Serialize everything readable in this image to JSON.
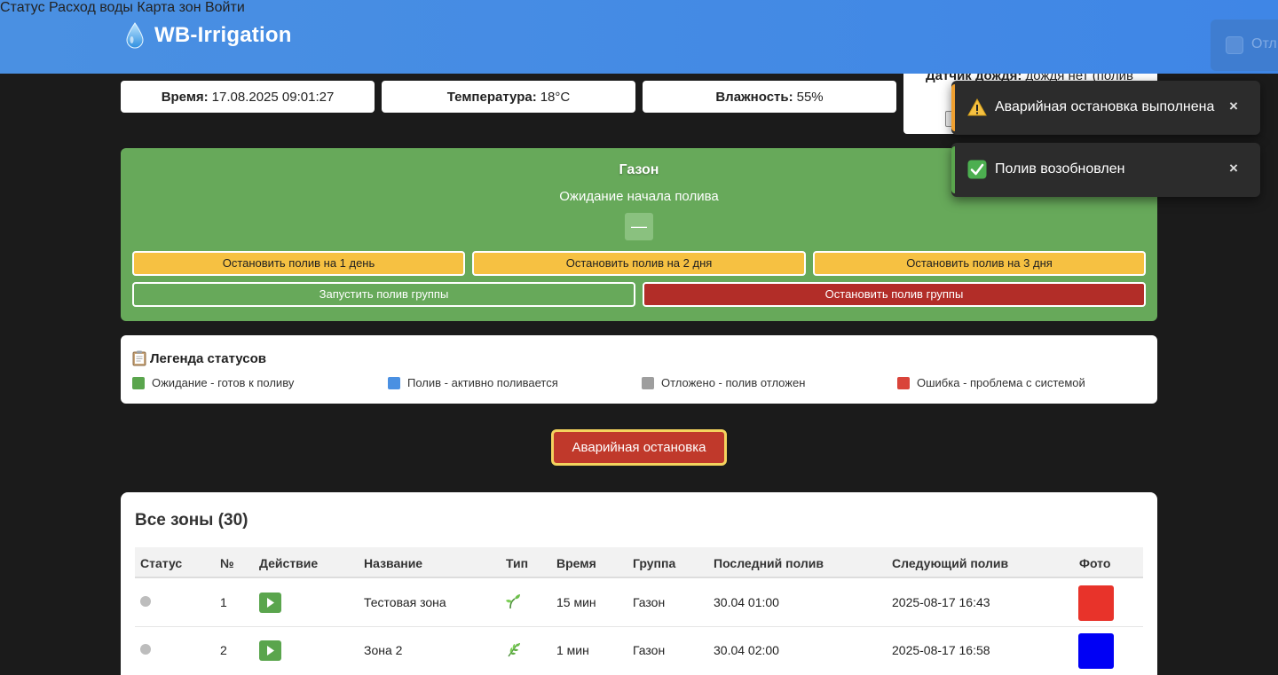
{
  "app": {
    "title": "WB-Irrigation"
  },
  "nav": [
    "Статус",
    "Расход воды",
    "Карта зон",
    "Войти"
  ],
  "ghost_toast": {
    "text": "Отл"
  },
  "info": {
    "time_label": "Время:",
    "time_value": "17.08.2025 09:01:27",
    "temp_label": "Температура:",
    "temp_value": "18°C",
    "humidity_label": "Влажность:",
    "humidity_value": "55%",
    "rain_label": "Датчик дождя:",
    "rain_value": "дождя нет (полив"
  },
  "group": {
    "title": "Газон",
    "status": "Ожидание начала полива",
    "dash": "—",
    "stop_buttons": [
      "Остановить полив на 1 день",
      "Остановить полив на 2 дня",
      "Остановить полив на 3 дня"
    ],
    "start_label": "Запустить полив группы",
    "stop_label": "Остановить полив группы"
  },
  "legend": {
    "title": "Легенда статусов",
    "items": [
      {
        "text": "Ожидание - готов к поливу",
        "color": "#5aa54d"
      },
      {
        "text": "Полив - активно поливается",
        "color": "#4a90e2"
      },
      {
        "text": "Отложено - полив отложен",
        "color": "#9e9e9e"
      },
      {
        "text": "Ошибка - проблема с системой",
        "color": "#d9443a"
      }
    ]
  },
  "emergency_label": "Аварийная остановка",
  "zones": {
    "title": "Все зоны (30)",
    "columns": [
      "Статус",
      "№",
      "Действие",
      "Название",
      "Тип",
      "Время",
      "Группа",
      "Последний полив",
      "Следующий полив",
      "Фото"
    ],
    "rows": [
      {
        "num": "1",
        "name": "Тестовая зона",
        "type_icon": "seedling-icon",
        "time": "15 мин",
        "group": "Газон",
        "last": "30.04 01:00",
        "next": "2025-08-17 16:43",
        "photo_color": "#e8332a"
      },
      {
        "num": "2",
        "name": "Зона 2",
        "type_icon": "herb-icon",
        "time": "1 мин",
        "group": "Газон",
        "last": "30.04 02:00",
        "next": "2025-08-17 16:58",
        "photo_color": "#0000f5"
      }
    ]
  },
  "toasts": [
    {
      "icon": "warning-icon",
      "message": "Аварийная остановка выполнена",
      "close": "×",
      "accent": "#f0a030"
    },
    {
      "icon": "check-icon",
      "message": "Полив возобновлен",
      "close": "×",
      "accent": "#5aa54d"
    }
  ]
}
